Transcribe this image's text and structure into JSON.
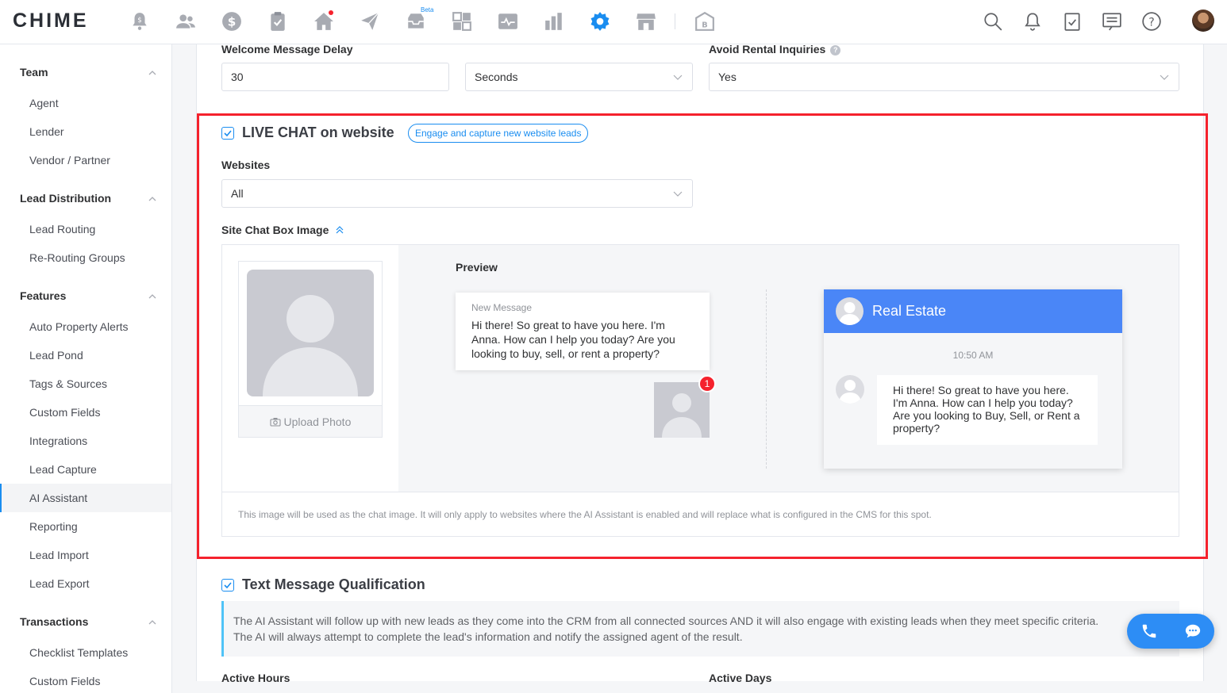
{
  "app": {
    "logo": "CHIME",
    "beta_label": "Beta"
  },
  "topnav": {
    "icons": [
      "bell-money-icon",
      "people-icon",
      "dollar-icon",
      "clipboard-check-icon",
      "home-icon",
      "paper-plane-icon",
      "inbox-icon",
      "dashboard-grid-icon",
      "activity-icon",
      "bar-chart-icon",
      "settings-gear-icon",
      "storefront-icon",
      "building-icon"
    ],
    "right_icons": [
      "search-icon",
      "notification-bell-icon",
      "tasks-clipboard-icon",
      "messages-icon",
      "help-icon"
    ],
    "accent": "#1a8df0"
  },
  "sidebar": {
    "sections": [
      {
        "title": "Team",
        "items": [
          "Agent",
          "Lender",
          "Vendor / Partner"
        ]
      },
      {
        "title": "Lead Distribution",
        "items": [
          "Lead Routing",
          "Re-Routing Groups"
        ]
      },
      {
        "title": "Features",
        "items": [
          "Auto Property Alerts",
          "Lead Pond",
          "Tags & Sources",
          "Custom Fields",
          "Integrations",
          "Lead Capture",
          "AI Assistant",
          "Reporting",
          "Lead Import",
          "Lead Export"
        ]
      },
      {
        "title": "Transactions",
        "items": [
          "Checklist Templates",
          "Custom Fields"
        ]
      }
    ],
    "active_item": "AI Assistant"
  },
  "welcome": {
    "label": "Welcome Message Delay",
    "value": "30",
    "unit": "Seconds"
  },
  "rental": {
    "label": "Avoid Rental Inquiries",
    "help": "?",
    "value": "Yes"
  },
  "live_chat": {
    "checked": true,
    "title": "LIVE CHAT on website",
    "pill": "Engage and capture new website leads",
    "websites_label": "Websites",
    "websites_value": "All",
    "image_label": "Site Chat Box Image",
    "upload_label": "Upload Photo",
    "preview_label": "Preview",
    "new_message_label": "New Message",
    "new_message_text": "Hi there! So great to have you here. I'm Anna. How can I help you today? Are you looking to buy, sell, or rent a property?",
    "badge_count": "1",
    "chat_title": "Real Estate",
    "chat_time": "10:50 AM",
    "chat_message": "Hi there! So great to have you here. I'm Anna. How can I help you today? Are you looking to Buy, Sell, or Rent a property?",
    "note": "This image will be used as the chat image. It will only apply to websites where the AI Assistant is enabled and will replace what is configured in the CMS for this spot."
  },
  "text_qual": {
    "checked": true,
    "title": "Text Message Qualification",
    "info_line1": "The AI Assistant will follow up with new leads as they come into the CRM from all connected sources AND it will also engage with existing leads when they meet specific criteria.",
    "info_line2": "The AI will always attempt to complete the lead's information and notify the assigned agent of the result.",
    "active_hours_label": "Active Hours",
    "active_days_label": "Active Days"
  },
  "fab": {
    "phone": "phone-icon",
    "chat": "chat-bubble-icon"
  },
  "colors": {
    "highlight": "#f5222d",
    "primary": "#1a8df0",
    "chat_header": "#4a86f7"
  }
}
